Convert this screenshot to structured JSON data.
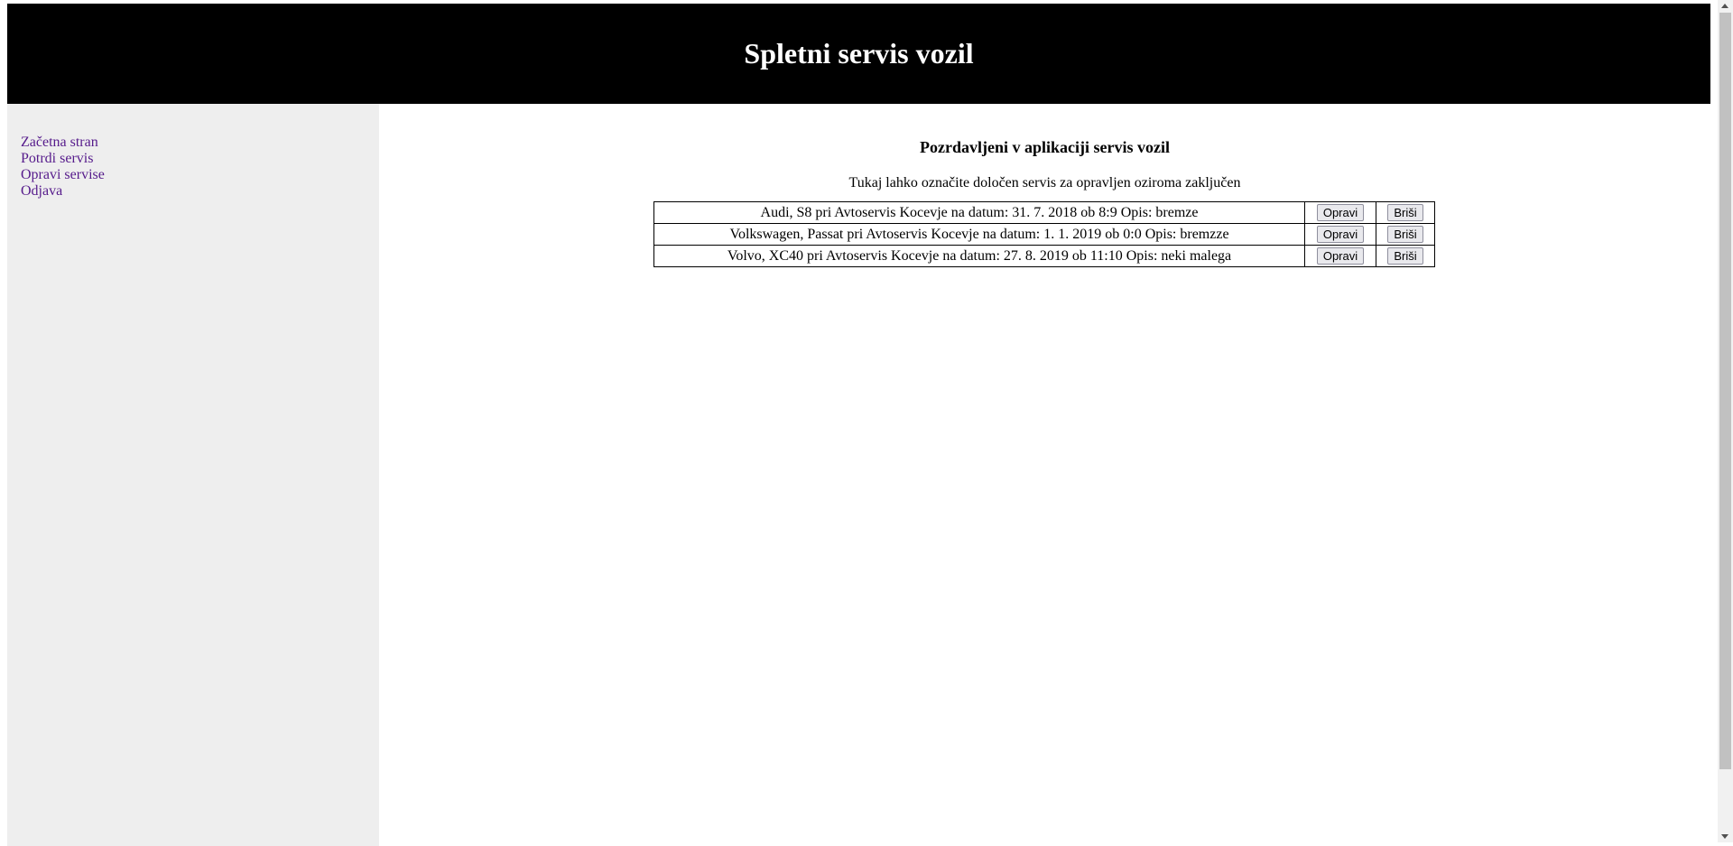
{
  "header": {
    "title": "Spletni servis vozil"
  },
  "sidebar": {
    "items": [
      {
        "label": "Začetna stran"
      },
      {
        "label": "Potrdi servis"
      },
      {
        "label": "Opravi servise"
      },
      {
        "label": "Odjava"
      }
    ]
  },
  "main": {
    "title": "Pozrdavljeni v aplikaciji servis vozil",
    "subtitle": "Tukaj lahko označite določen servis za opravljen oziroma zaključen",
    "services": [
      {
        "description": "Audi, S8 pri Avtoservis Kocevje na datum: 31. 7. 2018 ob 8:9 Opis: bremze",
        "complete_label": "Opravi",
        "delete_label": "Briši"
      },
      {
        "description": "Volkswagen, Passat pri Avtoservis Kocevje na datum: 1. 1. 2019 ob 0:0 Opis: bremzze",
        "complete_label": "Opravi",
        "delete_label": "Briši"
      },
      {
        "description": "Volvo, XC40 pri Avtoservis Kocevje na datum: 27. 8. 2019 ob 11:10 Opis: neki malega",
        "complete_label": "Opravi",
        "delete_label": "Briši"
      }
    ]
  },
  "colors": {
    "header_bg": "#000000",
    "header_text": "#ffffff",
    "sidebar_bg": "#eeeeee",
    "link": "#551a8b"
  }
}
